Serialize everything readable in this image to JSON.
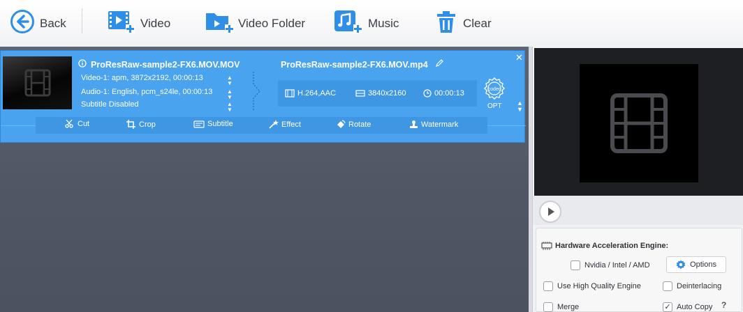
{
  "toolbar": {
    "back_label": "Back",
    "video_label": "Video",
    "video_folder_label": "Video Folder",
    "music_label": "Music",
    "clear_label": "Clear"
  },
  "item": {
    "source_title": "ProResRaw-sample2-FX6.MOV.MOV",
    "video_info": "Video-1: apm, 3872x2192, 00:00:13",
    "audio_info": "Audio-1: English, pcm_s24le, 00:00:13",
    "subtitle_info": "Subtitle Disabled",
    "output_title": "ProResRaw-sample2-FX6.MOV.mp4",
    "output_codec": "H.264,AAC",
    "output_resolution": "3840x2160",
    "output_duration": "00:00:13",
    "codec_badge": "codec",
    "opt_label": "OPT"
  },
  "edit_tools": {
    "cut": "Cut",
    "crop": "Crop",
    "subtitle": "Subtitle",
    "effect": "Effect",
    "rotate": "Rotate",
    "watermark": "Watermark"
  },
  "settings": {
    "hw_title": "Hardware Acceleration Engine:",
    "gpu_label": "Nvidia / Intel / AMD",
    "options_label": "Options",
    "hq_label": "Use High Quality Engine",
    "deinterlace_label": "Deinterlacing",
    "merge_label": "Merge",
    "autocopy_label": "Auto Copy",
    "help_glyph": "?",
    "gpu_checked": false,
    "hq_checked": false,
    "deinterlace_checked": false,
    "merge_checked": false,
    "autocopy_checked": true
  },
  "colors": {
    "accent_blue": "#4aa3ee",
    "icon_blue": "#2f8fe6"
  }
}
